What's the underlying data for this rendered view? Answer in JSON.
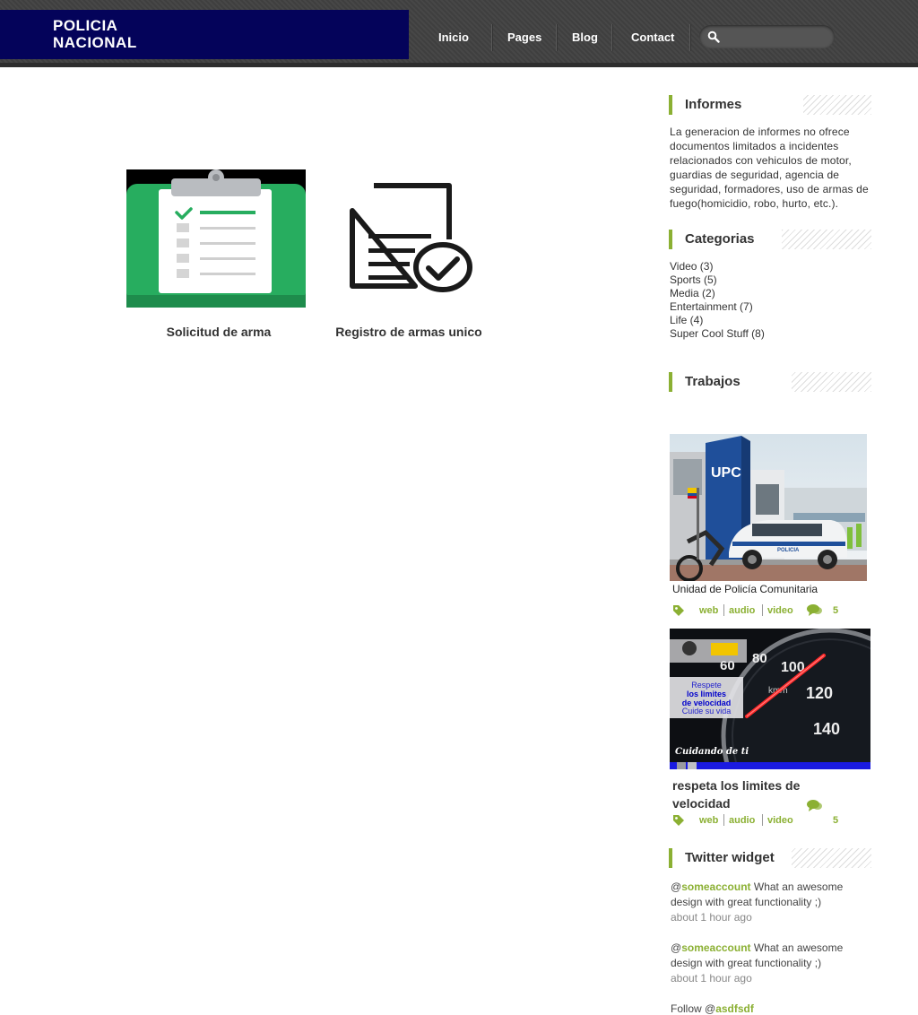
{
  "header": {
    "logo_line1": "POLICIA",
    "logo_line2": "NACIONAL",
    "nav": [
      "Inicio",
      "Pages",
      "Blog",
      "Contact"
    ],
    "search_placeholder": ""
  },
  "main": {
    "cards": [
      {
        "title": "Solicitud de arma"
      },
      {
        "title": "Registro de armas unico"
      }
    ]
  },
  "sidebar": {
    "informes": {
      "title": "Informes",
      "text": "La generacion de informes no ofrece documentos limitados a incidentes relacionados con vehiculos de motor, guardias de seguridad, agencia de seguridad, formadores, uso de armas de fuego(homicidio, robo, hurto, etc.)."
    },
    "categorias": {
      "title": "Categorias",
      "items": [
        "Video (3)",
        "Sports (5)",
        "Media (2)",
        "Entertainment (7)",
        "Life (4)",
        "Super Cool Stuff (8)"
      ]
    },
    "trabajos": {
      "title": "Trabajos",
      "posts": [
        {
          "title": "Unidad de Policía Comunitaria",
          "tags": [
            "web",
            "audio",
            "video"
          ],
          "comments": "5",
          "image": {
            "sign": "UPC",
            "car_label": "POLICIA"
          }
        },
        {
          "title": "respeta los limites de velocidad",
          "tags": [
            "web",
            "audio",
            "video"
          ],
          "comments": "5",
          "image": {
            "line1": "Respete",
            "line2": "los limites",
            "line3": "de velocidad",
            "line4": "Cuide su vida",
            "footer": "Cuidando de ti",
            "unit": "km/h",
            "gauge_numbers": [
              "60",
              "80",
              "100",
              "120",
              "140"
            ]
          }
        }
      ]
    },
    "twitter": {
      "title": "Twitter widget",
      "tweets": [
        {
          "at": "@",
          "account": "someaccount",
          "text": " What an awesome design with great functionality ;)",
          "time": "about 1 hour ago"
        },
        {
          "at": "@",
          "account": "someaccount",
          "text": " What an awesome design with great functionality ;)",
          "time": "about 1 hour ago"
        }
      ],
      "follow_prefix": "Follow @",
      "follow_account": "asdfsdf"
    }
  },
  "colors": {
    "accent": "#8bb033",
    "logo_bg": "#04035a",
    "header_bg": "#444444"
  }
}
